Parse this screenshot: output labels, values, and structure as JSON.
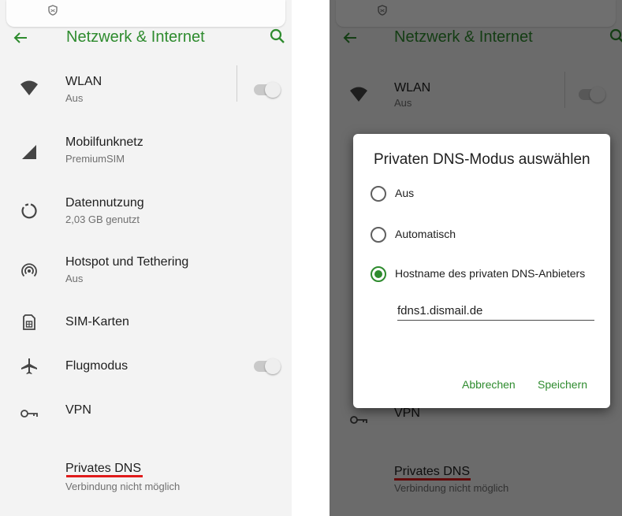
{
  "header": {
    "title": "Netzwerk & Internet"
  },
  "settings": [
    {
      "title": "WLAN",
      "subtitle": "Aus",
      "icon": "wifi-icon",
      "toggle": false
    },
    {
      "title": "Mobilfunknetz",
      "subtitle": "PremiumSIM",
      "icon": "signal-icon"
    },
    {
      "title": "Datennutzung",
      "subtitle": "2,03 GB genutzt",
      "icon": "data-usage-icon"
    },
    {
      "title": "Hotspot und Tethering",
      "subtitle": "Aus",
      "icon": "hotspot-icon"
    },
    {
      "title": "SIM-Karten",
      "subtitle": "",
      "icon": "sim-card-icon"
    },
    {
      "title": "Flugmodus",
      "subtitle": "",
      "icon": "airplane-icon",
      "toggle": false
    },
    {
      "title": "VPN",
      "subtitle": "",
      "icon": "vpn-key-icon"
    },
    {
      "title": "Privates DNS",
      "subtitle": "Verbindung nicht möglich"
    }
  ],
  "dialog": {
    "title": "Privaten DNS-Modus auswählen",
    "options": [
      "Aus",
      "Automatisch",
      "Hostname des privaten DNS-Anbieters"
    ],
    "selected_option": "Hostname des privaten DNS-Anbieters",
    "hostname_value": "fdns1.dismail.de",
    "cancel_label": "Abbrechen",
    "save_label": "Speichern"
  },
  "colors": {
    "accent": "#2e8b2e",
    "highlight_underline": "#e01b1b",
    "background": "#f3f3f3",
    "scrim": "#000000"
  }
}
